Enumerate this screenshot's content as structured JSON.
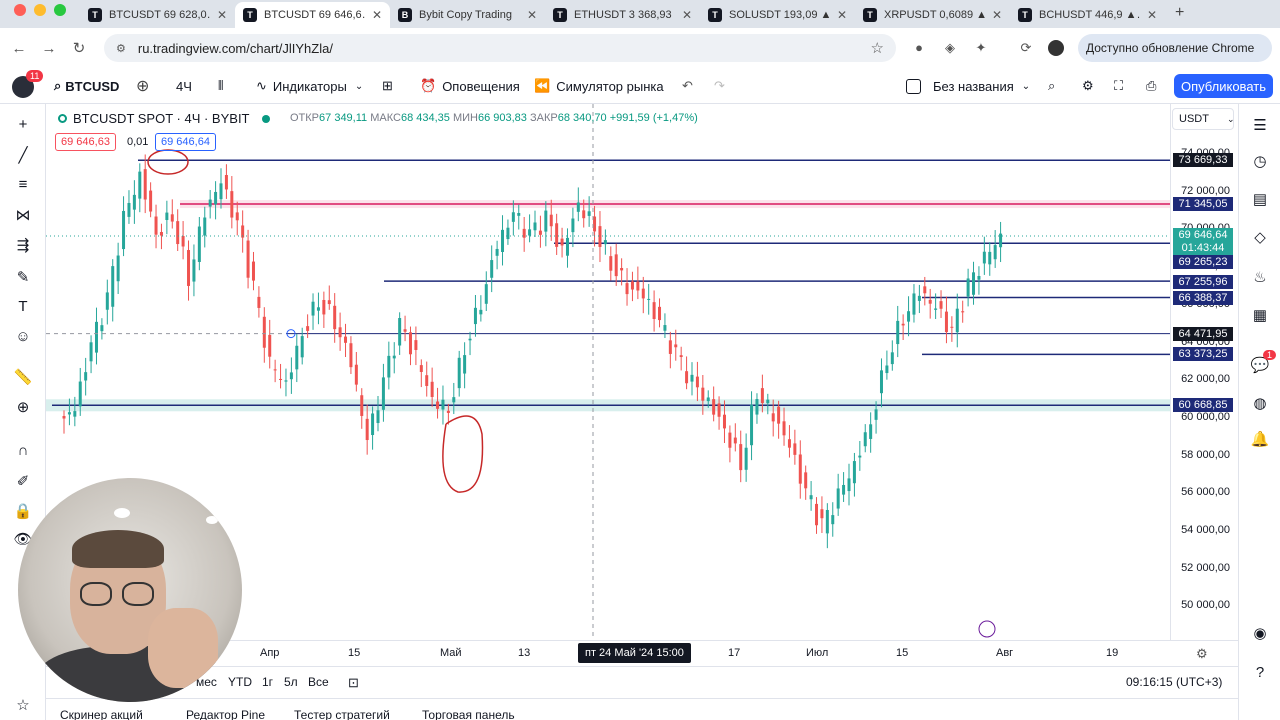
{
  "browser": {
    "tabs": [
      {
        "label": "BTCUSDT 69 628,0…",
        "active": false
      },
      {
        "label": "BTCUSDT 69 646,6…",
        "active": true
      },
      {
        "label": "Bybit Copy Trading",
        "active": false
      },
      {
        "label": "ETHUSDT 3 368,93 …",
        "active": false
      },
      {
        "label": "SOLUSDT 193,09 ▲…",
        "active": false
      },
      {
        "label": "XRPUSDT 0,6089 ▲…",
        "active": false
      },
      {
        "label": "BCHUSDT 446,9 ▲…",
        "active": false
      }
    ],
    "url": "ru.tradingview.com/chart/JlIYhZla/",
    "update_label": "Доступно обновление Chrome"
  },
  "toolbar": {
    "notif_count": "11",
    "symbol": "BTCUSD",
    "interval": "4Ч",
    "indicators_label": "Индикаторы",
    "alerts_label": "Оповещения",
    "replay_label": "Симулятор рынка",
    "layout_name": "Без названия",
    "publish_label": "Опубликовать"
  },
  "legend": {
    "title": "BTCUSDT SPOT · 4Ч · BYBIT",
    "open_label": "ОТКР",
    "open": "67 349,11",
    "high_label": "МАКС",
    "high": "68 434,35",
    "low_label": "МИН",
    "low": "66 903,83",
    "close_label": "ЗАКР",
    "close": "68 340,70",
    "change": "+991,59 (+1,47%)",
    "bid": "69 646,63",
    "spread": "0,01",
    "ask": "69 646,64"
  },
  "price_axis": {
    "currency": "USDT",
    "ticks": [
      "74 000,00",
      "72 000,00",
      "70 000,00",
      "68 000,00",
      "66 000,00",
      "64 000,00",
      "62 000,00",
      "60 000,00",
      "58 000,00",
      "56 000,00",
      "54 000,00",
      "52 000,00",
      "50 000,00"
    ],
    "labels": [
      {
        "text": "73 669,33",
        "color": "#131722"
      },
      {
        "text": "71 345,05",
        "color": "#1e2a78"
      },
      {
        "text": "69 646,64",
        "color": "#26a69a"
      },
      {
        "text": "01:43:44",
        "color": "#26a69a"
      },
      {
        "text": "69 265,23",
        "color": "#1e2a78"
      },
      {
        "text": "67 255,96",
        "color": "#1e2a78"
      },
      {
        "text": "66 388,37",
        "color": "#1e2a78"
      },
      {
        "text": "64 471,95",
        "color": "#131722"
      },
      {
        "text": "63 373,25",
        "color": "#1e2a78"
      },
      {
        "text": "60 668,85",
        "color": "#1e2a78"
      }
    ]
  },
  "time_axis": {
    "ticks": [
      "Апр",
      "15",
      "Май",
      "13",
      "17",
      "Июл",
      "15",
      "Авг",
      "19"
    ],
    "cursor": "пт 24 Май '24   15:00"
  },
  "range_bar": {
    "items": [
      "мес",
      "YTD",
      "1г",
      "5л",
      "Все"
    ],
    "clock": "09:16:15 (UTC+3)"
  },
  "bottom_tabs": [
    "Скринер акций",
    "Редактор Pine",
    "Тестер стратегий",
    "Торговая панель"
  ],
  "right_badge": "1",
  "colors": {
    "up": "#26a69a",
    "down": "#ef5350",
    "level": "#1e2a78",
    "accent": "#2962ff"
  },
  "chart_data": {
    "type": "candlestick",
    "symbol": "BTCUSDT SPOT",
    "interval": "4Ч",
    "y_range": [
      49000,
      75000
    ],
    "horizontal_levels": [
      73669.33,
      71345.05,
      69265.23,
      67255.96,
      66388.37,
      64471.95,
      63373.25,
      60668.85
    ],
    "last_price": 69646.64,
    "approx_closes": [
      60500,
      63800,
      66200,
      70500,
      72800,
      69800,
      70800,
      67500,
      71000,
      72500,
      70200,
      66800,
      62800,
      61800,
      64500,
      66300,
      65200,
      63000,
      58800,
      61800,
      64800,
      63200,
      61000,
      60500,
      63800,
      66200,
      69200,
      70800,
      69600,
      70500,
      68800,
      71400,
      70200,
      68300,
      67000,
      66500,
      65000,
      63300,
      61800,
      60800,
      59500,
      57600,
      61500,
      60200,
      58500,
      56000,
      54200,
      55800,
      57500,
      59800,
      63200,
      65400,
      66800,
      65800,
      64500,
      66900,
      68400,
      69646
    ]
  }
}
